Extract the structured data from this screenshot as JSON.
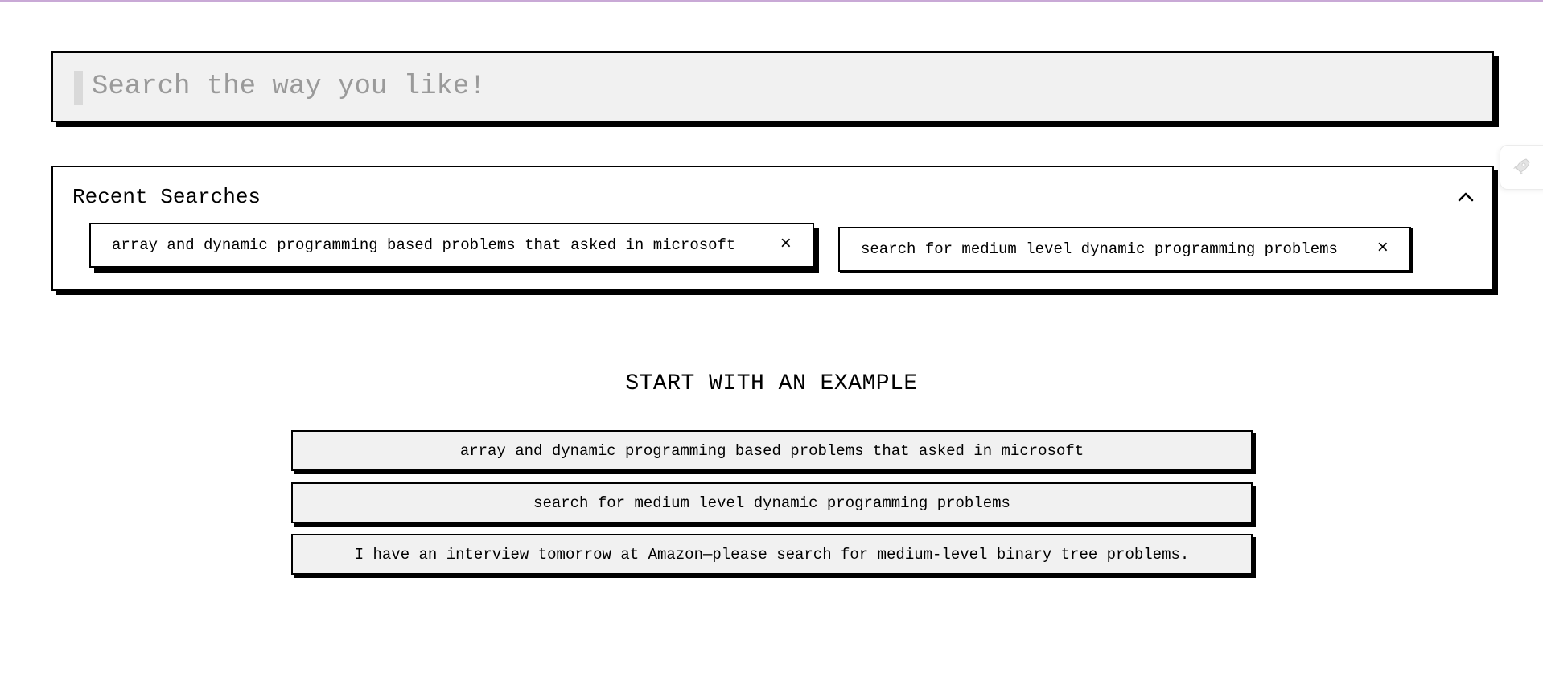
{
  "search": {
    "placeholder": "Search the way you like!",
    "value": ""
  },
  "recent": {
    "title": "Recent Searches",
    "collapse_icon": "chevron-up-icon",
    "items": [
      {
        "label": "array and dynamic programming based problems that asked in microsoft",
        "remove_symbol": "×"
      },
      {
        "label": "search for medium level dynamic programming problems",
        "remove_symbol": "×"
      }
    ]
  },
  "examples": {
    "heading": "START WITH AN EXAMPLE",
    "items": [
      {
        "label": "array and dynamic programming based problems that asked in microsoft"
      },
      {
        "label": "search for medium level dynamic programming problems"
      },
      {
        "label": "I have an interview tomorrow at Amazon—please search for medium-level binary tree problems."
      }
    ]
  },
  "side_widget": {
    "icon": "rocket-icon"
  },
  "colors": {
    "accent_line": "#c9a9d6",
    "input_bg": "#f1f1f1",
    "border": "#000000",
    "placeholder": "#9a9a9a"
  }
}
